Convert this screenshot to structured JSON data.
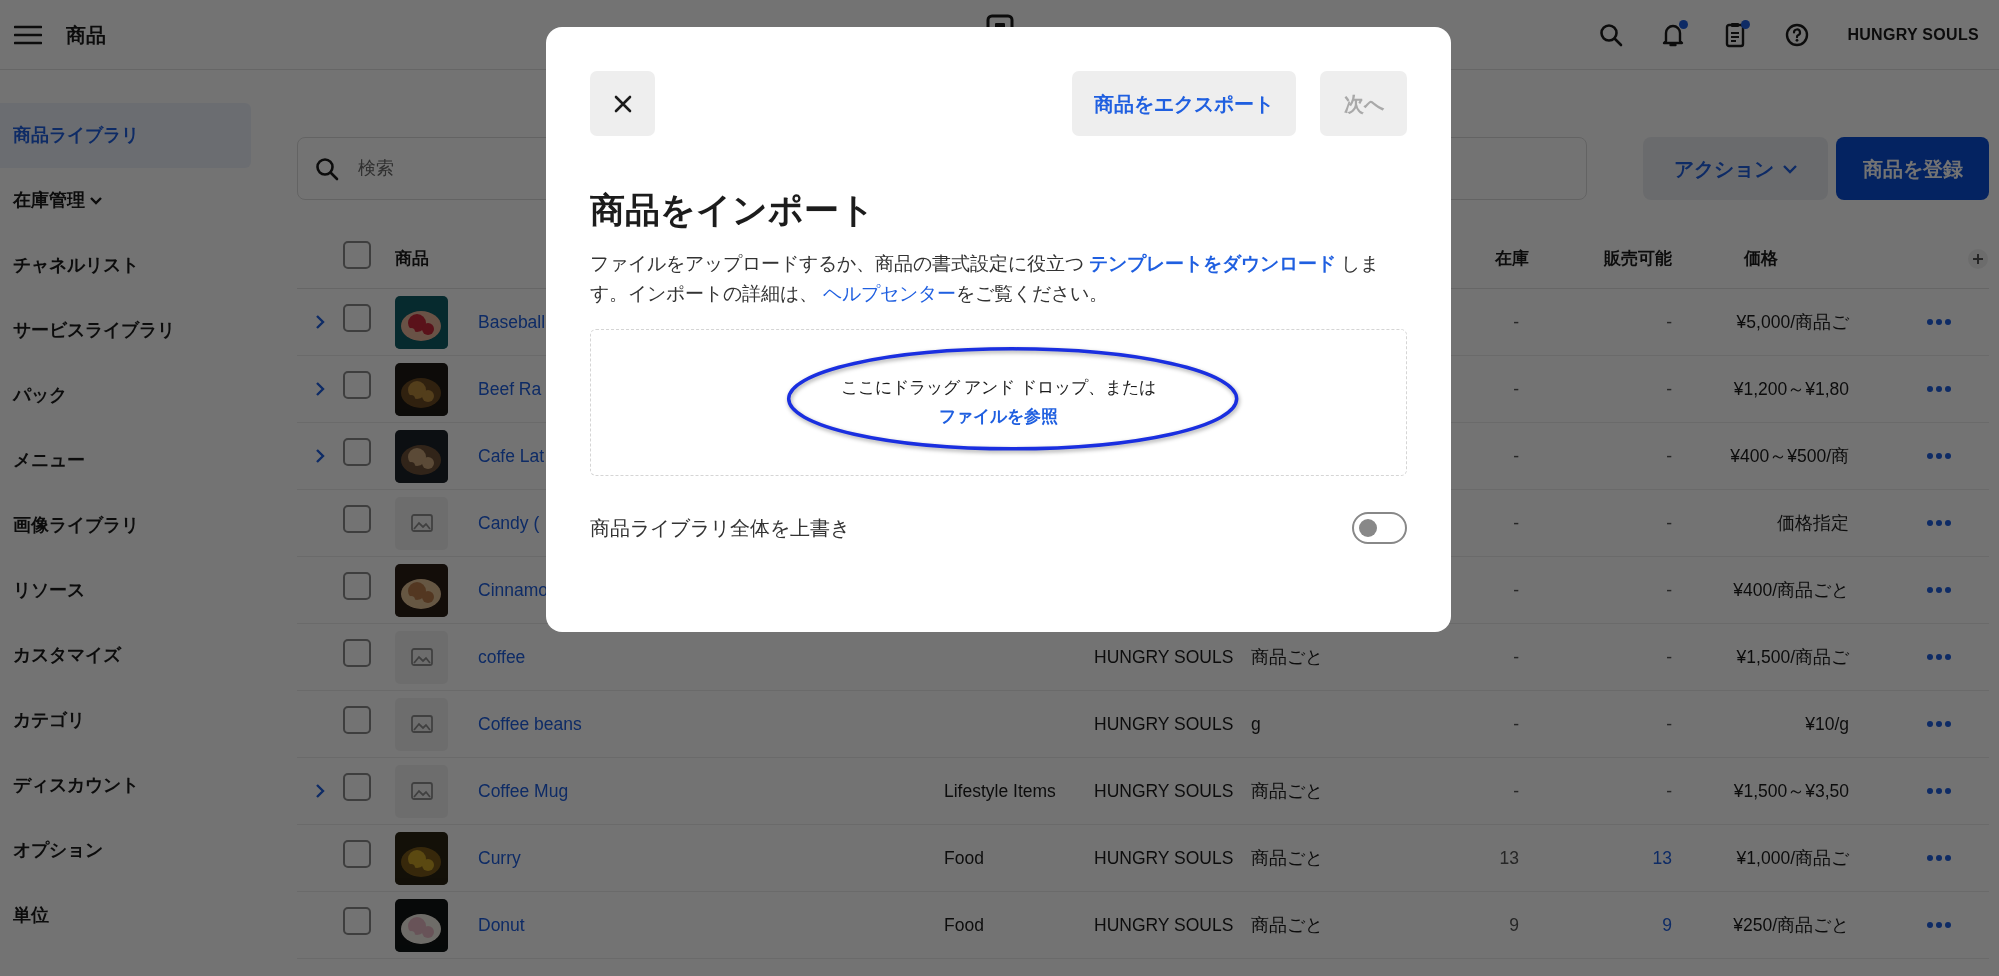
{
  "topbar": {
    "title": "商品",
    "account": "HUNGRY SOULS",
    "bell_dot": true,
    "tasks_dot": true
  },
  "sidebar": {
    "items": [
      {
        "label": "商品ライブラリ",
        "kind": "link",
        "selected": true
      },
      {
        "label": "在庫管理",
        "kind": "group",
        "selected": false
      },
      {
        "label": "チャネルリスト",
        "kind": "link",
        "selected": false
      },
      {
        "label": "サービスライブラリ",
        "kind": "link",
        "selected": false
      },
      {
        "label": "パック",
        "kind": "link",
        "selected": false
      },
      {
        "label": "メニュー",
        "kind": "link",
        "selected": false
      },
      {
        "label": "画像ライブラリ",
        "kind": "link",
        "selected": false
      },
      {
        "label": "リソース",
        "kind": "link",
        "selected": false
      },
      {
        "label": "カスタマイズ",
        "kind": "link",
        "selected": false
      },
      {
        "label": "カテゴリ",
        "kind": "link",
        "selected": false
      },
      {
        "label": "ディスカウント",
        "kind": "link",
        "selected": false
      },
      {
        "label": "オプション",
        "kind": "link",
        "selected": false
      },
      {
        "label": "単位",
        "kind": "link",
        "selected": false
      }
    ]
  },
  "toolbar": {
    "search": {
      "placeholder": "検索"
    },
    "actions_button": "アクション",
    "create_button": "商品を登録"
  },
  "table": {
    "select_all": false,
    "columns": {
      "product": "商品",
      "stock": "在庫",
      "available": "販売可能",
      "price": "価格"
    },
    "rows": [
      {
        "expandable": true,
        "checked": false,
        "name": "Baseball",
        "stock": "-",
        "available": "-",
        "available_link": false,
        "price": "¥5,000/商品ご"
      },
      {
        "expandable": true,
        "checked": false,
        "name": "Beef Ra",
        "stock": "-",
        "available": "-",
        "available_link": false,
        "price": "¥1,200～¥1,80"
      },
      {
        "expandable": true,
        "checked": false,
        "name": "Cafe Lat",
        "stock": "-",
        "available": "-",
        "available_link": false,
        "price": "¥400～¥500/商"
      },
      {
        "expandable": false,
        "checked": false,
        "kind": "placeholder",
        "name": "Candy (",
        "stock": "-",
        "available": "-",
        "available_link": false,
        "price": "価格指定"
      },
      {
        "expandable": false,
        "checked": false,
        "name": "Cinnamo",
        "stock": "-",
        "available": "-",
        "available_link": false,
        "price": "¥400/商品ごと"
      },
      {
        "expandable": false,
        "checked": false,
        "kind": "placeholder",
        "name": "coffee",
        "location": "HUNGRY SOULS",
        "unit": "商品ごと",
        "stock": "-",
        "available": "-",
        "available_link": false,
        "price": "¥1,500/商品ご"
      },
      {
        "expandable": false,
        "checked": false,
        "kind": "placeholder",
        "name": "Coffee beans",
        "location": "HUNGRY SOULS",
        "unit": "g",
        "stock": "-",
        "available": "-",
        "available_link": false,
        "price": "¥10/g"
      },
      {
        "expandable": true,
        "checked": false,
        "kind": "placeholder",
        "name": "Coffee Mug",
        "category": "Lifestyle Items",
        "location": "HUNGRY SOULS",
        "unit": "商品ごと",
        "stock": "-",
        "available": "-",
        "available_link": false,
        "price": "¥1,500～¥3,50"
      },
      {
        "expandable": false,
        "checked": false,
        "name": "Curry",
        "category": "Food",
        "location": "HUNGRY SOULS",
        "unit": "商品ごと",
        "stock": "13",
        "available": "13",
        "available_link": true,
        "price": "¥1,000/商品ご"
      },
      {
        "expandable": false,
        "checked": false,
        "name": "Donut",
        "category": "Food",
        "location": "HUNGRY SOULS",
        "unit": "商品ごと",
        "stock": "9",
        "available": "9",
        "available_link": true,
        "price": "¥250/商品ごと"
      }
    ]
  },
  "modal": {
    "export_button": "商品をエクスポート",
    "next_button": "次へ",
    "next_disabled": true,
    "title": "商品をインポート",
    "text_before": "ファイルをアップロードするか、商品の書式設定に役立つ",
    "template_link": "テンプレートをダウンロード",
    "text_middle": "します。インポートの詳細は、",
    "help_link": "ヘルプセンター",
    "text_after": "をご覧ください。",
    "dropzone": {
      "text": "ここにドラッグ アンド ドロップ、または",
      "browse_link": "ファイルを参照"
    },
    "overwrite": {
      "label": "商品ライブラリ全体を上書き",
      "on": false
    }
  }
}
